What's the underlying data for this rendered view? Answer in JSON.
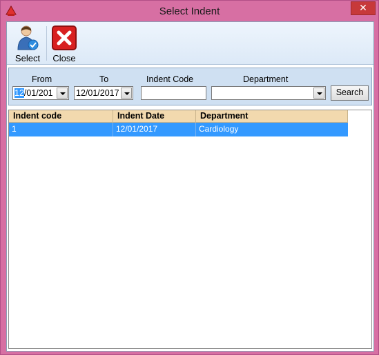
{
  "window": {
    "title": "Select Indent",
    "close_glyph": "✕"
  },
  "toolbar": {
    "select_label": "Select",
    "close_label": "Close"
  },
  "filters": {
    "from_label": "From",
    "from_selected": "12",
    "from_rest": "/01/201",
    "to_label": "To",
    "to_value": "12/01/2017",
    "indent_code_label": "Indent Code",
    "indent_code_value": "",
    "department_label": "Department",
    "department_value": "",
    "search_label": "Search"
  },
  "grid": {
    "columns": [
      "Indent code",
      "Indent Date",
      "Department"
    ],
    "rows": [
      {
        "indent_code": "1",
        "indent_date": "12/01/2017",
        "department": "Cardiology"
      }
    ]
  },
  "colors": {
    "titlebar": "#d76fa3",
    "header": "#f2d9ae",
    "selection": "#3399ff"
  }
}
